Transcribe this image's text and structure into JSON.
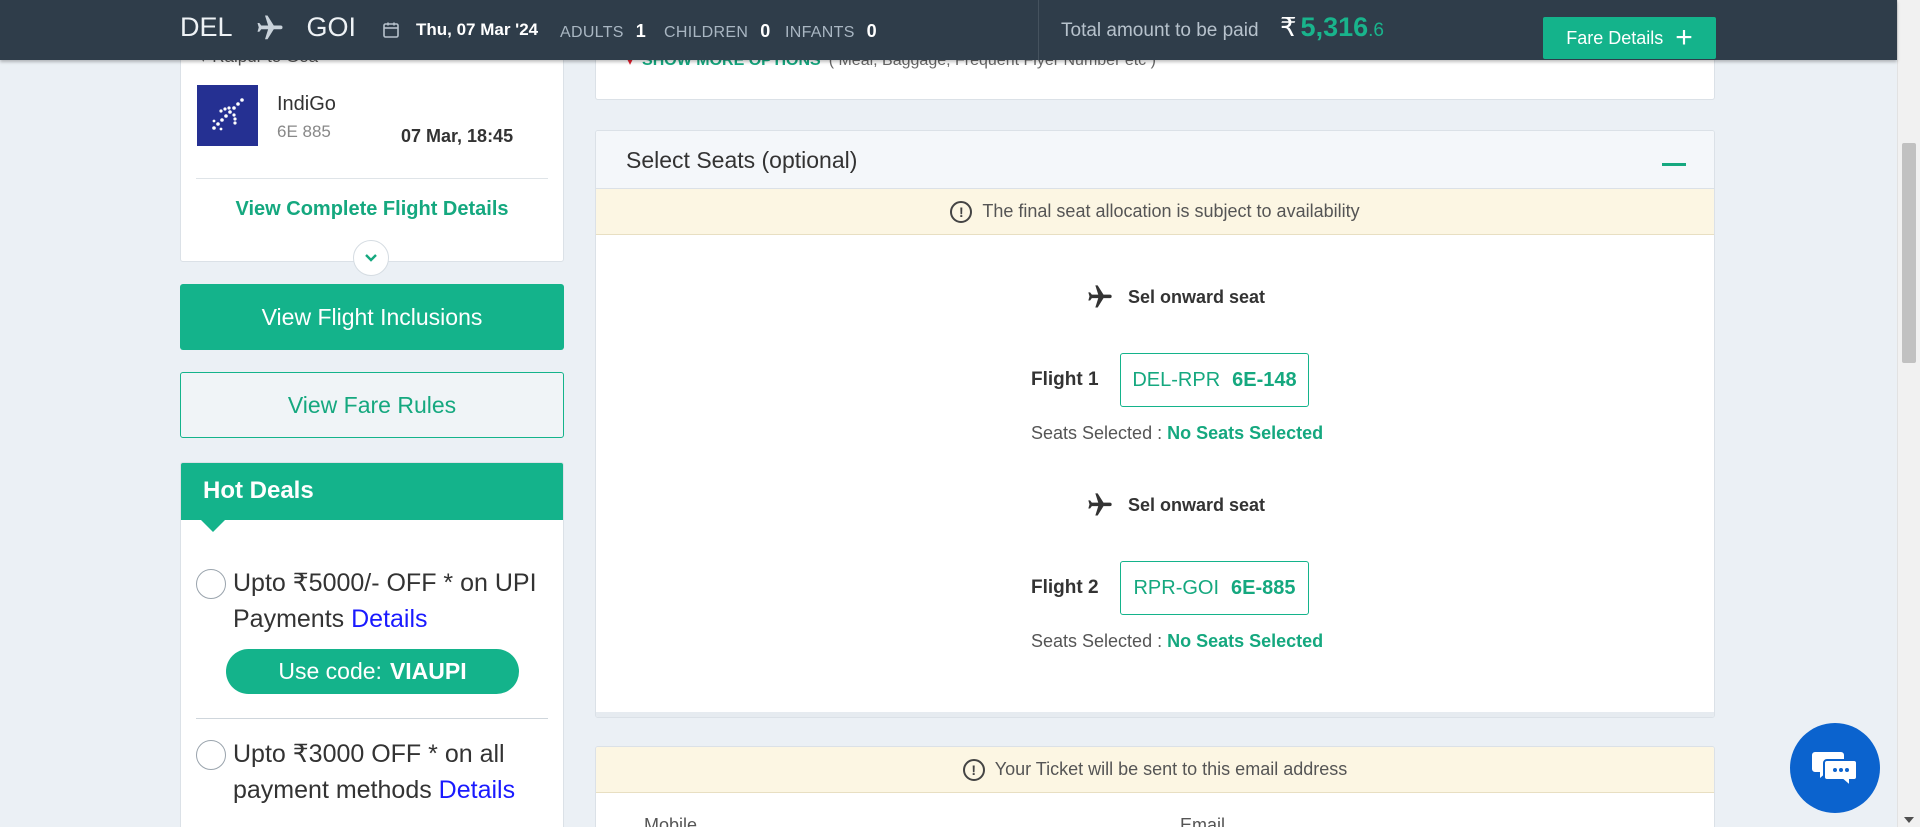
{
  "header": {
    "origin": "DEL",
    "destination": "GOI",
    "date": "Thu, 07 Mar '24",
    "adults_label": "ADULTS",
    "adults_count": "1",
    "children_label": "CHILDREN",
    "children_count": "0",
    "infants_label": "INFANTS",
    "infants_count": "0",
    "total_label": "Total amount to be paid",
    "currency_symbol": "₹",
    "total_whole": "5,316",
    "total_decimal": ".6",
    "fare_details_label": "Fare Details",
    "fare_details_icon": "+"
  },
  "flight_card": {
    "sub_route": "Raipur to Goa",
    "airline": "IndiGo",
    "flight_number": "6E 885",
    "departure": "07 Mar, 18:45",
    "complete_details_link": "View Complete Flight Details"
  },
  "sidebar_buttons": {
    "inclusions": "View Flight Inclusions",
    "fare_rules": "View Fare Rules"
  },
  "hot_deals": {
    "title": "Hot Deals",
    "deals": [
      {
        "text": "Upto ₹5000/- OFF * on UPI Payments",
        "link": "Details",
        "code_prefix": "Use code:",
        "code": "VIAUPI"
      },
      {
        "text": "Upto ₹3000 OFF * on all payment methods",
        "link": "Details"
      }
    ]
  },
  "extras": {
    "label": "SHOW MORE OPTIONS",
    "hint": "( Meal, Baggage, Frequent Flyer Number etc )"
  },
  "seats": {
    "title": "Select Seats (optional)",
    "notice": "The final seat allocation is subject to availability",
    "segments": [
      {
        "heading": "Sel onward seat",
        "flight_label": "Flight 1",
        "route": "DEL-RPR",
        "flight_no": "6E-148",
        "selected_label": "Seats Selected :",
        "selected_value": "No Seats Selected"
      },
      {
        "heading": "Sel onward seat",
        "flight_label": "Flight 2",
        "route": "RPR-GOI",
        "flight_no": "6E-885",
        "selected_label": "Seats Selected :",
        "selected_value": "No Seats Selected"
      }
    ]
  },
  "ticket": {
    "notice": "Your Ticket will be sent to this email address",
    "mobile_label": "Mobile",
    "email_label": "Email"
  },
  "colors": {
    "accent": "#14b38b",
    "header_bg": "#2f3d4a",
    "chat_bg": "#0b63ce",
    "notice_bg": "#fcf6e3"
  }
}
